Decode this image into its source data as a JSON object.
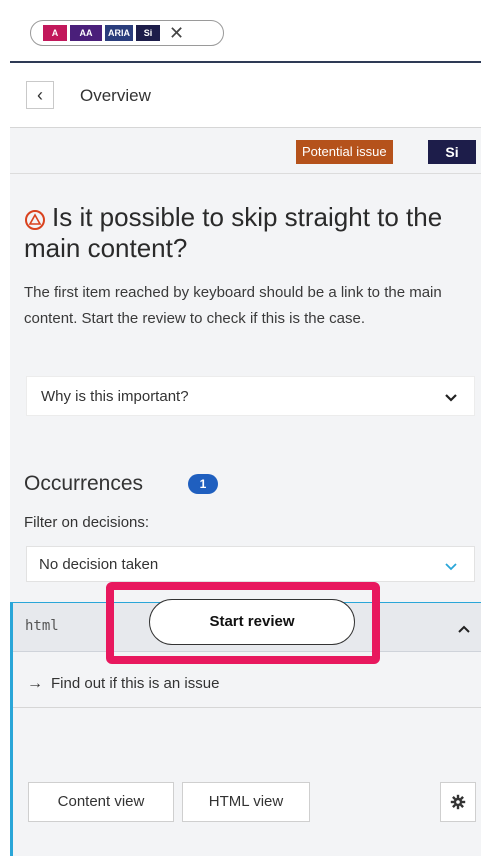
{
  "tags": {
    "items": [
      "A",
      "AA",
      "ARIA",
      "Si"
    ],
    "close_glyph": "✕"
  },
  "nav": {
    "back_glyph": "‹",
    "title": "Overview"
  },
  "badges": {
    "issue": "Potential issue",
    "category": "Si"
  },
  "check": {
    "title": "Is it possible to skip straight to the main content?",
    "description": "The first item reached by keyboard should be a link to the main content. Start the review to check if this is the case.",
    "why_label": "Why is this important?"
  },
  "occurrences": {
    "title": "Occurrences",
    "count": "1",
    "filter_label": "Filter on decisions:",
    "filter_value": "No decision taken"
  },
  "card": {
    "code": "html",
    "find_label": "Find out if this is an issue",
    "find_arrow": "→",
    "start_button": "Start review"
  },
  "footer": {
    "content_view": "Content view",
    "html_view": "HTML view"
  },
  "colors": {
    "accent_blue": "#2aa6d8",
    "issue_badge": "#b5521b",
    "highlight": "#e8185e",
    "warning_icon": "#d9421e"
  }
}
